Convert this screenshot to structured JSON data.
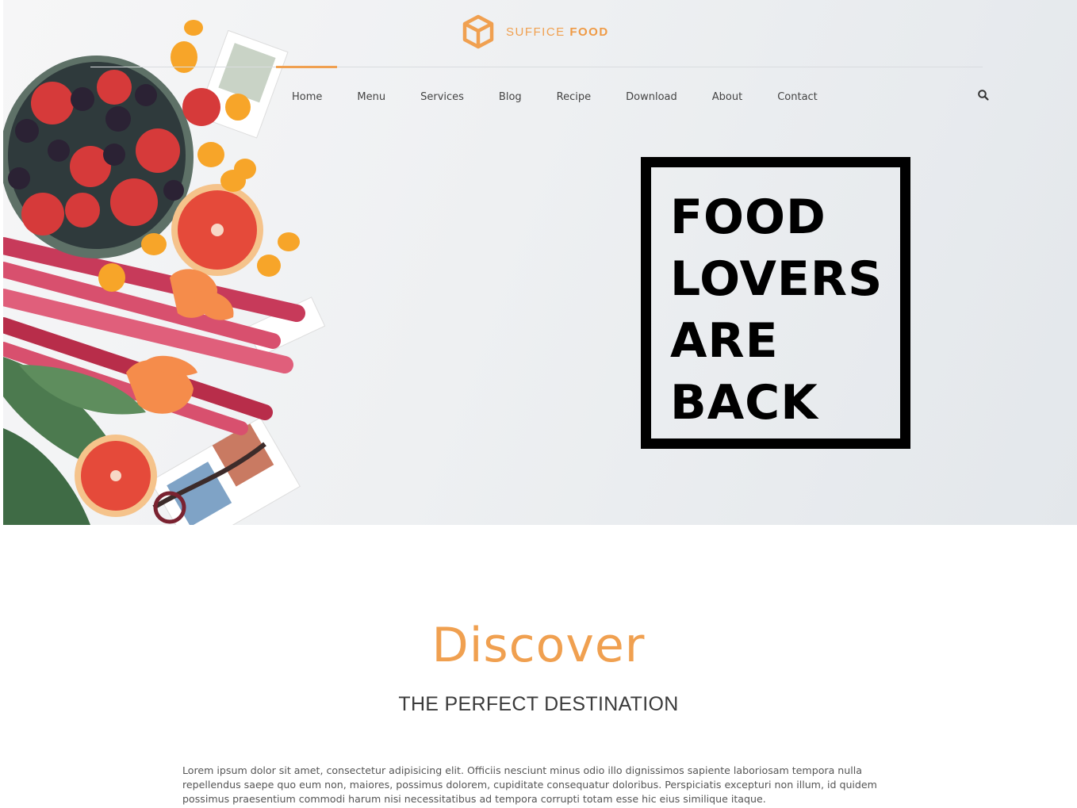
{
  "header": {
    "brand": {
      "first": "SUFFICE",
      "second": "FOOD",
      "logo_icon": "cube-logo-icon"
    },
    "nav": [
      {
        "label": "Home",
        "active": true
      },
      {
        "label": "Menu"
      },
      {
        "label": "Services"
      },
      {
        "label": "Blog"
      },
      {
        "label": "Recipe"
      },
      {
        "label": "Download"
      },
      {
        "label": "About"
      },
      {
        "label": "Contact"
      }
    ],
    "search_icon": "search-icon"
  },
  "hero": {
    "headline": [
      "FOOD",
      "LOVERS",
      "ARE",
      "BACK"
    ],
    "image": "fruit-and-rhubarb-collage"
  },
  "section": {
    "script_title": "Discover",
    "subtitle": "THE PERFECT DESTINATION",
    "body": "Lorem ipsum dolor sit amet, consectetur adipisicing elit. Officiis nesciunt minus odio illo dignissimos sapiente laboriosam tempora nulla repellendus saepe quo eum non, maiores, possimus dolorem, cupiditate consequatur doloribus. Perspiciatis excepturi non illum, id quidem possimus praesentium commodi harum nisi necessitatibus ad tempora corrupti totam esse hic eius similique itaque."
  },
  "colors": {
    "accent": "#f0a050",
    "text": "#333333",
    "headline": "#000000"
  }
}
